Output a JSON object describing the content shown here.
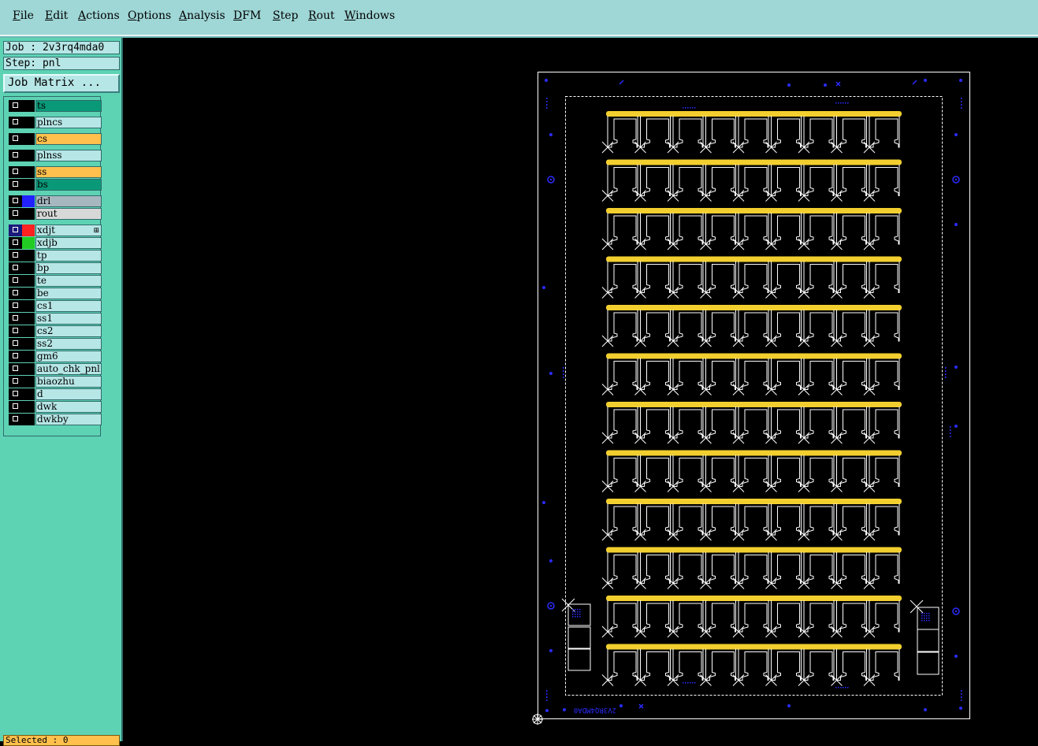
{
  "menu": [
    {
      "label": "File"
    },
    {
      "label": "Edit"
    },
    {
      "label": "Actions"
    },
    {
      "label": "Options"
    },
    {
      "label": "Analysis"
    },
    {
      "label": "DFM"
    },
    {
      "label": "Step"
    },
    {
      "label": "Rout"
    },
    {
      "label": "Windows"
    }
  ],
  "job": {
    "job_line": "Job : 2v3rq4mda0",
    "step_line": "Step: pnl",
    "matrix_button": "Job Matrix ..."
  },
  "layers": [
    {
      "name": "ts",
      "color": "#0a9978",
      "swatch": ""
    },
    {
      "name": "plncs",
      "color": "#b7e6e6",
      "swatch": ""
    },
    {
      "name": "cs",
      "color": "#ffc04d",
      "swatch": ""
    },
    {
      "name": "plnss",
      "color": "#b7e6e6",
      "swatch": ""
    },
    {
      "name": "ss",
      "color": "#ffc04d",
      "swatch": ""
    },
    {
      "name": "bs",
      "color": "#0a9978",
      "swatch": ""
    },
    {
      "name": "drl",
      "color": "#a7b7c0",
      "swatch": "#2222ff"
    },
    {
      "name": "rout",
      "color": "#d8d8d8",
      "swatch": ""
    },
    {
      "name": "xdjt",
      "color": "#b7e6e6",
      "swatch": "#ff2020",
      "active": true
    },
    {
      "name": "xdjb",
      "color": "#b7e6e6",
      "swatch": "#22cc22"
    },
    {
      "name": "tp",
      "color": "#b7e6e6",
      "swatch": ""
    },
    {
      "name": "bp",
      "color": "#b7e6e6",
      "swatch": ""
    },
    {
      "name": "te",
      "color": "#b7e6e6",
      "swatch": ""
    },
    {
      "name": "be",
      "color": "#b7e6e6",
      "swatch": ""
    },
    {
      "name": "cs1",
      "color": "#b7e6e6",
      "swatch": ""
    },
    {
      "name": "ss1",
      "color": "#b7e6e6",
      "swatch": ""
    },
    {
      "name": "cs2",
      "color": "#b7e6e6",
      "swatch": ""
    },
    {
      "name": "ss2",
      "color": "#b7e6e6",
      "swatch": ""
    },
    {
      "name": "gm6",
      "color": "#b7e6e6",
      "swatch": ""
    },
    {
      "name": "auto_chk_pnl",
      "color": "#b7e6e6",
      "swatch": ""
    },
    {
      "name": "biaozhu",
      "color": "#b7e6e6",
      "swatch": ""
    },
    {
      "name": "d",
      "color": "#b7e6e6",
      "swatch": ""
    },
    {
      "name": "dwk",
      "color": "#b7e6e6",
      "swatch": ""
    },
    {
      "name": "dwkby",
      "color": "#b7e6e6",
      "swatch": ""
    }
  ],
  "status": {
    "text": "Selected : 0"
  },
  "board": {
    "rows": 12,
    "cols": 9,
    "trace_color": "#ffffff",
    "pad_color": "#f2cf2e",
    "fiducial_color": "#2b2bff",
    "label": "2V3RQ4MDA0"
  }
}
